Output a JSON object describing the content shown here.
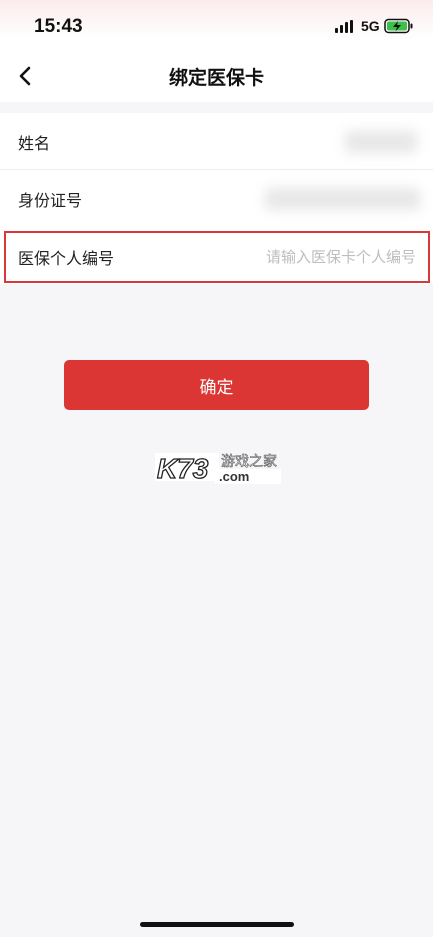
{
  "status_bar": {
    "time": "15:43",
    "network": "5G",
    "icons": [
      "signal-icon",
      "battery-charging-icon"
    ]
  },
  "nav": {
    "back_icon": "chevron-left-icon",
    "title": "绑定医保卡"
  },
  "form": {
    "name_label": "姓名",
    "id_label": "身份证号",
    "insurance_label": "医保个人编号",
    "insurance_placeholder": "请输入医保卡个人编号",
    "insurance_value": ""
  },
  "confirm_label": "确定",
  "watermark": {
    "brand": "K73",
    "subtitle": "游戏之家",
    "domain": ".com"
  },
  "colors": {
    "accent": "#db3634",
    "highlight_border": "#d9383a",
    "background": "#f6f6f8"
  }
}
